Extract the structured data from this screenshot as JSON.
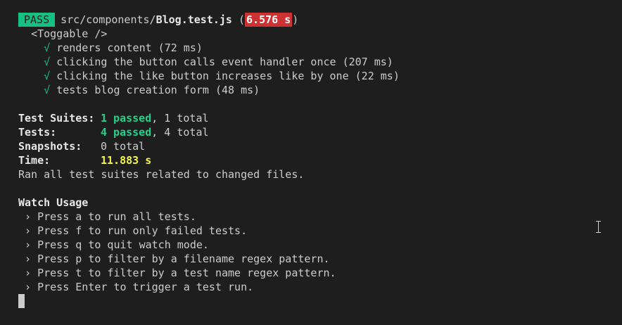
{
  "header": {
    "status": "PASS",
    "path_prefix": "src/components/",
    "file_name": "Blog.test.js",
    "open_paren": " (",
    "duration": "6.576 s",
    "close_paren": ")"
  },
  "suite": {
    "describe": "<Toggable />",
    "check_glyph": "√",
    "tests": [
      {
        "name": "renders content (72 ms)"
      },
      {
        "name": "clicking the button calls event handler once (207 ms)"
      },
      {
        "name": "clicking the like button increases like by one (22 ms)"
      },
      {
        "name": "tests blog creation form (48 ms)"
      }
    ]
  },
  "summary": {
    "suites_label": "Test Suites:",
    "suites_passed": "1 passed",
    "suites_total": ", 1 total",
    "tests_label": "Tests:",
    "tests_passed": "4 passed",
    "tests_total": ", 4 total",
    "snapshots_label": "Snapshots:",
    "snapshots_value": "0 total",
    "time_label": "Time:",
    "time_value": "11.883 s",
    "ran_message": "Ran all test suites related to changed files."
  },
  "watch": {
    "title": "Watch Usage",
    "options": [
      {
        "text": " › Press a to run all tests."
      },
      {
        "text": " › Press f to run only failed tests."
      },
      {
        "text": " › Press q to quit watch mode."
      },
      {
        "text": " › Press p to filter by a filename regex pattern."
      },
      {
        "text": " › Press t to filter by a test name regex pattern."
      },
      {
        "text": " › Press Enter to trigger a test run."
      }
    ]
  },
  "colors": {
    "background": "#1e1e1e",
    "pass_green": "#16c083",
    "slow_red": "#cd3131",
    "time_yellow": "#f5f543"
  },
  "icons": {
    "pointer": "text-cursor-icon",
    "prompt": "block-cursor-icon"
  }
}
